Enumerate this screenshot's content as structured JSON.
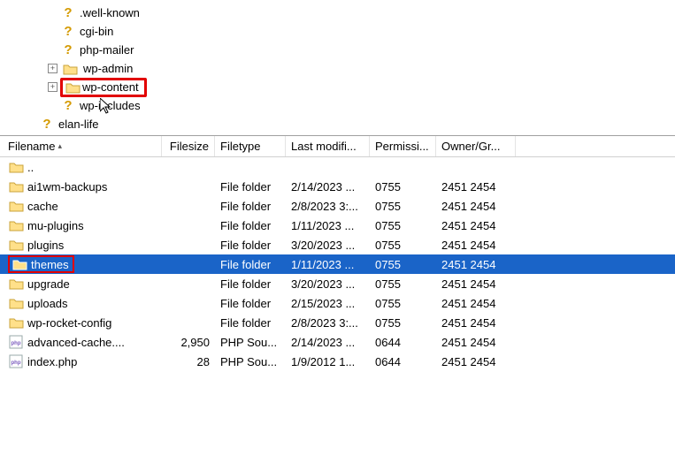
{
  "tree": [
    {
      "depth": 1,
      "expander": "",
      "iconType": "question",
      "label": ".well-known"
    },
    {
      "depth": 1,
      "expander": "",
      "iconType": "question",
      "label": "cgi-bin"
    },
    {
      "depth": 1,
      "expander": "",
      "iconType": "question",
      "label": "php-mailer"
    },
    {
      "depth": 1,
      "expander": "+",
      "iconType": "folder",
      "label": "wp-admin"
    },
    {
      "depth": 1,
      "expander": "+",
      "iconType": "folder",
      "label": "wp-content",
      "highlight": true
    },
    {
      "depth": 1,
      "expander": "",
      "iconType": "question",
      "label": "wp-includes"
    },
    {
      "depth": 0,
      "expander": "",
      "iconType": "question",
      "label": "elan-life"
    }
  ],
  "columns": {
    "name": "Filename",
    "size": "Filesize",
    "type": "Filetype",
    "mod": "Last modifi...",
    "perm": "Permissi...",
    "own": "Owner/Gr..."
  },
  "rows": [
    {
      "icon": "folder",
      "name": "..",
      "size": "",
      "type": "",
      "mod": "",
      "perm": "",
      "own": ""
    },
    {
      "icon": "folder",
      "name": "ai1wm-backups",
      "size": "",
      "type": "File folder",
      "mod": "2/14/2023 ...",
      "perm": "0755",
      "own": "2451 2454"
    },
    {
      "icon": "folder",
      "name": "cache",
      "size": "",
      "type": "File folder",
      "mod": "2/8/2023 3:...",
      "perm": "0755",
      "own": "2451 2454"
    },
    {
      "icon": "folder",
      "name": "mu-plugins",
      "size": "",
      "type": "File folder",
      "mod": "1/11/2023 ...",
      "perm": "0755",
      "own": "2451 2454"
    },
    {
      "icon": "folder",
      "name": "plugins",
      "size": "",
      "type": "File folder",
      "mod": "3/20/2023 ...",
      "perm": "0755",
      "own": "2451 2454"
    },
    {
      "icon": "folder",
      "name": "themes",
      "size": "",
      "type": "File folder",
      "mod": "1/11/2023 ...",
      "perm": "0755",
      "own": "2451 2454",
      "selected": true,
      "highlight": true
    },
    {
      "icon": "folder",
      "name": "upgrade",
      "size": "",
      "type": "File folder",
      "mod": "3/20/2023 ...",
      "perm": "0755",
      "own": "2451 2454"
    },
    {
      "icon": "folder",
      "name": "uploads",
      "size": "",
      "type": "File folder",
      "mod": "2/15/2023 ...",
      "perm": "0755",
      "own": "2451 2454"
    },
    {
      "icon": "folder",
      "name": "wp-rocket-config",
      "size": "",
      "type": "File folder",
      "mod": "2/8/2023 3:...",
      "perm": "0755",
      "own": "2451 2454"
    },
    {
      "icon": "php",
      "name": "advanced-cache....",
      "size": "2,950",
      "type": "PHP Sou...",
      "mod": "2/14/2023 ...",
      "perm": "0644",
      "own": "2451 2454"
    },
    {
      "icon": "php",
      "name": "index.php",
      "size": "28",
      "type": "PHP Sou...",
      "mod": "1/9/2012 1...",
      "perm": "0644",
      "own": "2451 2454"
    }
  ]
}
